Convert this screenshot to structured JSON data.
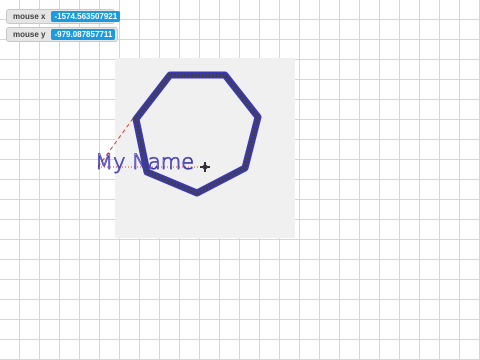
{
  "monitors": {
    "mouse_x": {
      "label": "mouse x",
      "value": "-1574.563507921"
    },
    "mouse_y": {
      "label": "mouse y",
      "value": "-979.087857711"
    }
  },
  "canvas": {
    "sprite_label": "My Name",
    "colors": {
      "heptagon_fill": "#404040",
      "heptagon_edge": "#3c38b4",
      "guide_line": "#e03c3c",
      "label_text": "#3c38b4",
      "sprite_area": "#f0f0f0"
    }
  }
}
